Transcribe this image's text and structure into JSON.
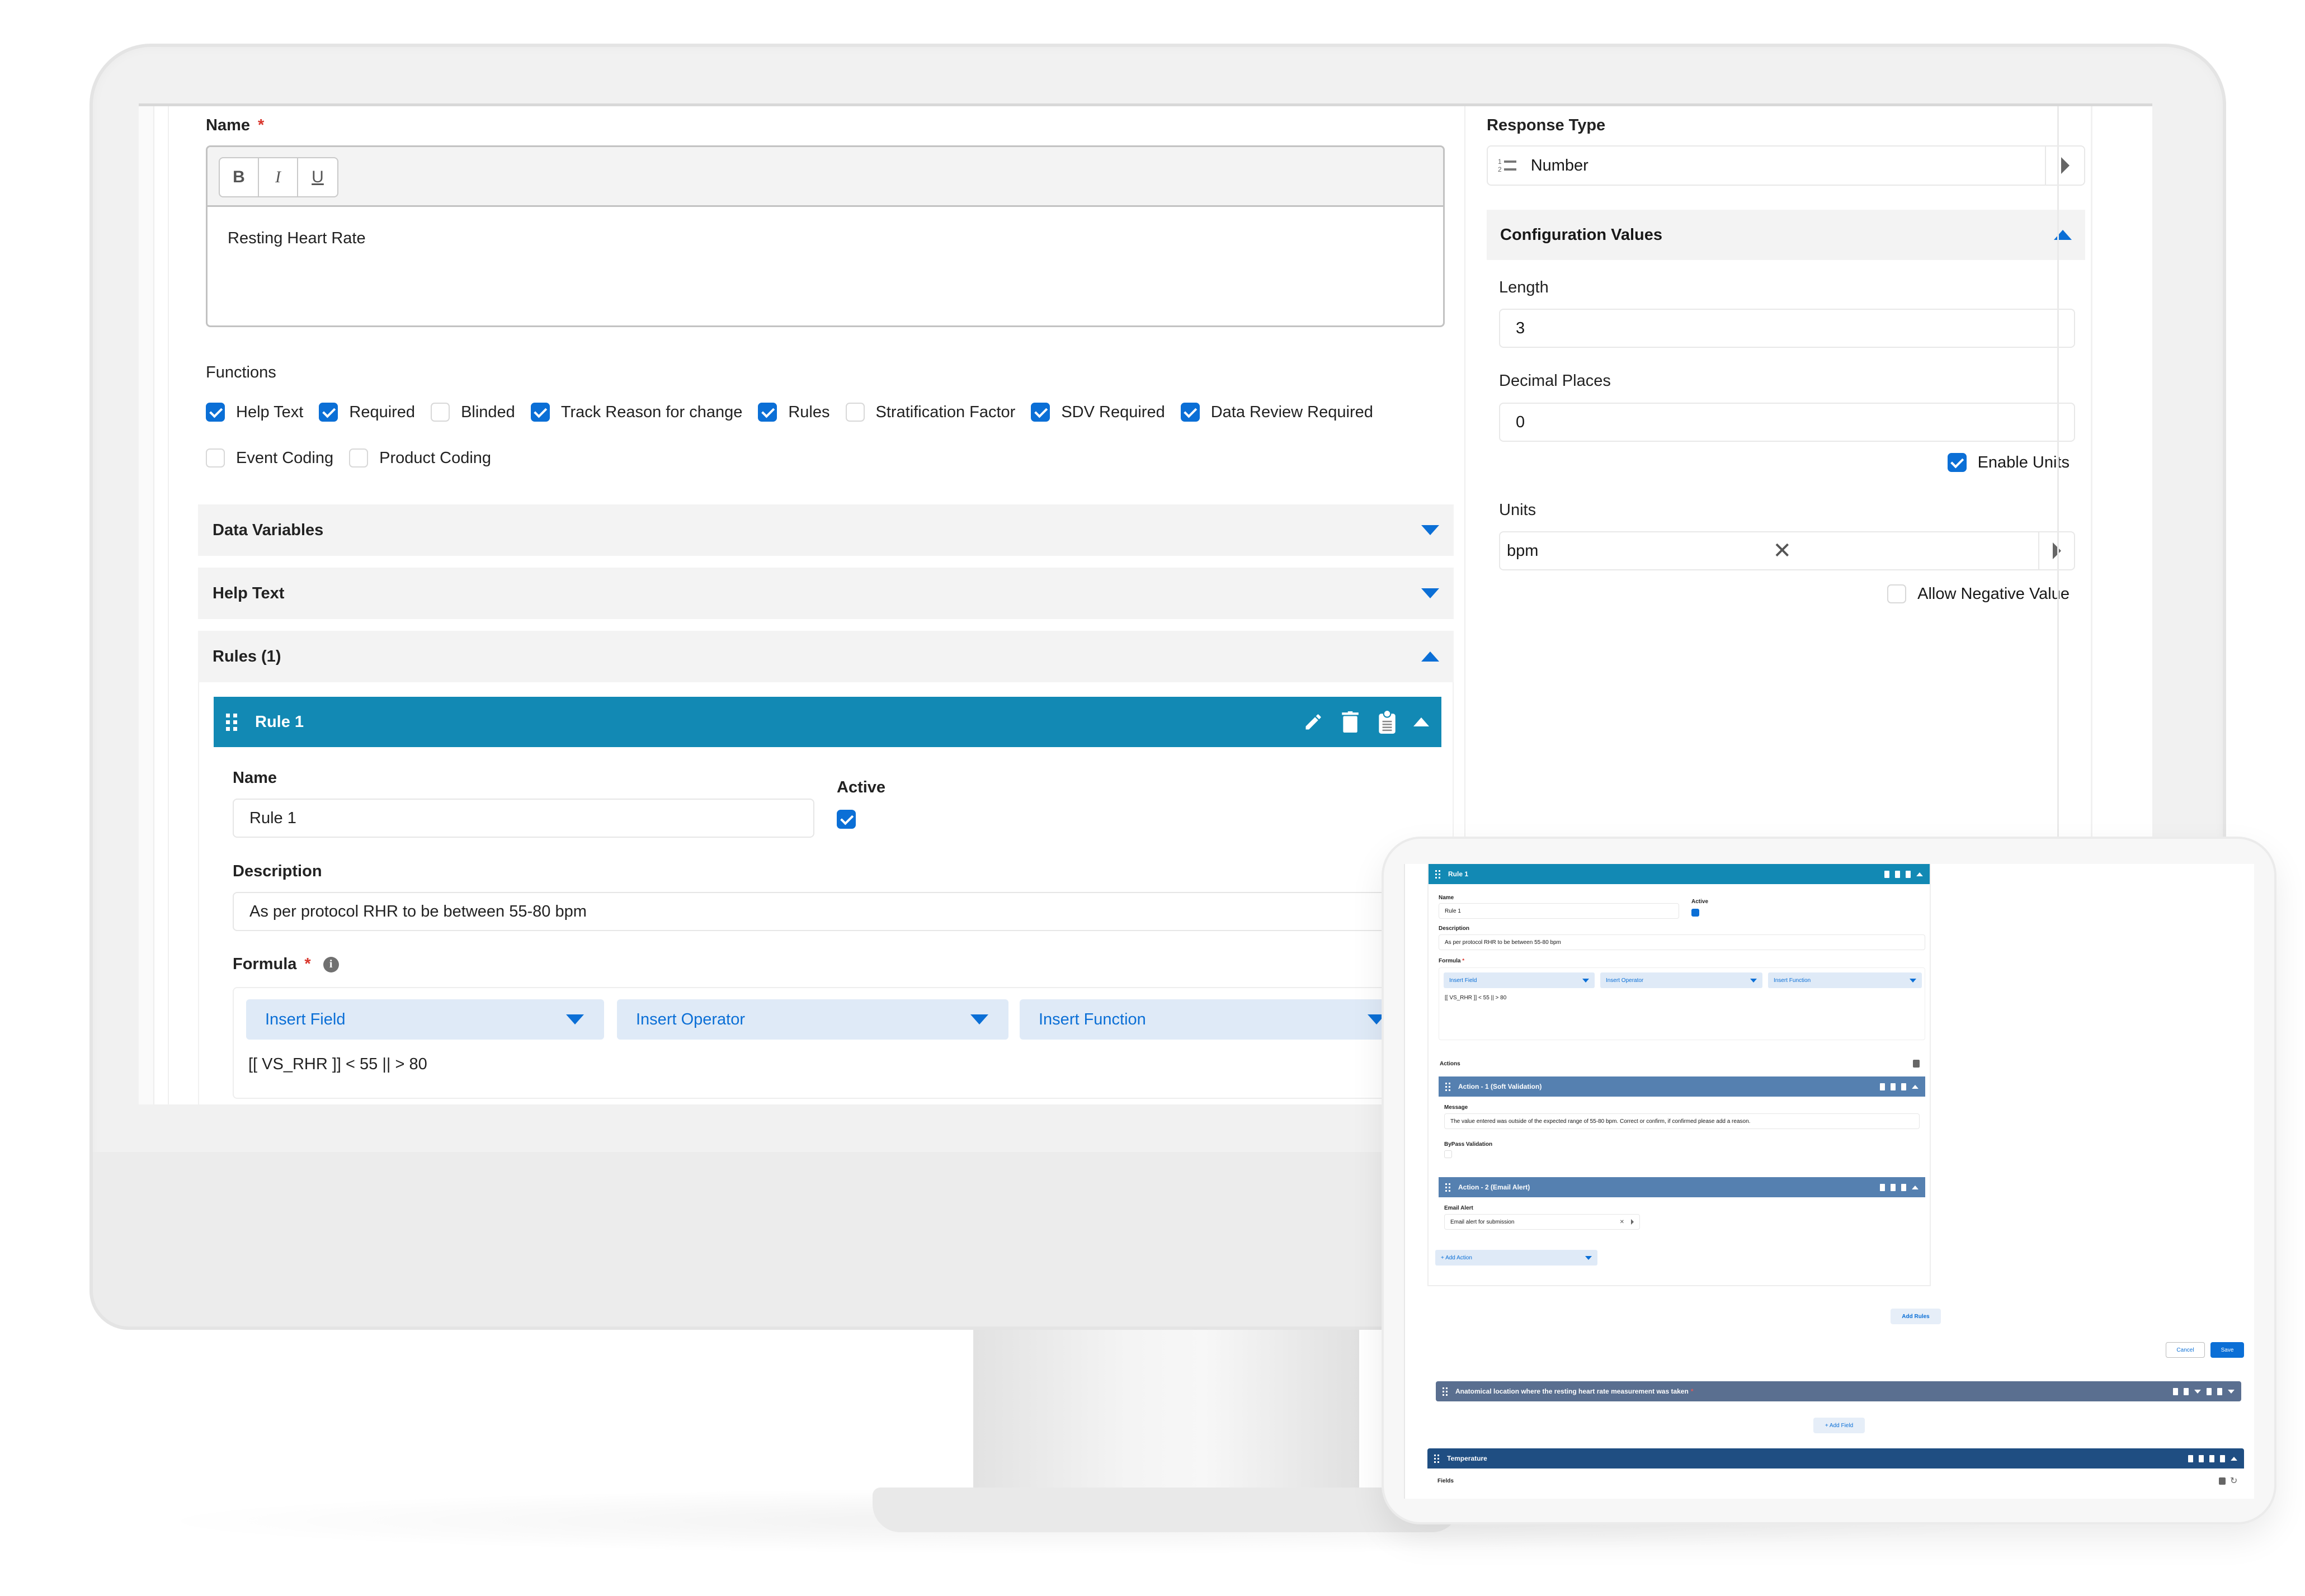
{
  "colors": {
    "accent_blue": "#0b6fd6",
    "rule_header": "#1289b4",
    "action_header": "#5580b0",
    "field_header": "#5a6f90",
    "section_header": "#1f4e82",
    "insert_bg": "#dfeaf7",
    "required_star": "#d9362c"
  },
  "form": {
    "name_label": "Name",
    "required_mark": "*",
    "toolbar": {
      "bold": "B",
      "italic": "I",
      "underline": "U"
    },
    "name_value": "Resting Heart Rate",
    "functions_label": "Functions",
    "functions": [
      {
        "label": "Help Text",
        "checked": true
      },
      {
        "label": "Required",
        "checked": true
      },
      {
        "label": "Blinded",
        "checked": false
      },
      {
        "label": "Track Reason for change",
        "checked": true
      },
      {
        "label": "Rules",
        "checked": true
      },
      {
        "label": "Stratification Factor",
        "checked": false
      },
      {
        "label": "SDV Required",
        "checked": true
      },
      {
        "label": "Data Review Required",
        "checked": true
      },
      {
        "label": "Event Coding",
        "checked": false
      },
      {
        "label": "Product Coding",
        "checked": false
      }
    ],
    "sections": {
      "data_variables": "Data Variables",
      "help_text": "Help Text",
      "rules": "Rules (1)"
    }
  },
  "rule": {
    "title": "Rule 1",
    "name_label": "Name",
    "name_value": "Rule 1",
    "active_label": "Active",
    "active": true,
    "description_label": "Description",
    "description_value": "As per protocol RHR to be between 55-80 bpm",
    "formula_label": "Formula",
    "insert_field": "Insert Field",
    "insert_operator": "Insert Operator",
    "insert_function": "Insert Function",
    "formula_value": "[[ VS_RHR ]]  < 55 ||  > 80"
  },
  "config": {
    "response_type_label": "Response Type",
    "response_type_value": "Number",
    "config_values_label": "Configuration Values",
    "length_label": "Length",
    "length_value": "3",
    "decimal_label": "Decimal Places",
    "decimal_value": "0",
    "enable_units_label": "Enable Units",
    "enable_units": true,
    "units_label": "Units",
    "units_value": "bpm",
    "allow_negative_label": "Allow Negative Value",
    "allow_negative": false
  },
  "tablet": {
    "actions_label": "Actions",
    "action1_title": "Action - 1 (Soft Validation)",
    "message_label": "Message",
    "message_value": "The value entered was outside of the expected range of 55-80 bpm. Correct or confirm, if confirmed please add a reason.",
    "bypass_label": "ByPass Validation",
    "action2_title": "Action - 2 (Email Alert)",
    "email_alert_label": "Email Alert",
    "email_alert_value": "Email alert for submission",
    "add_action": "+ Add Action",
    "add_rules": "Add Rules",
    "cancel": "Cancel",
    "save": "Save",
    "field_title": "Anatomical location where the resting heart rate measurement was taken",
    "add_field": "+ Add Field",
    "section_title": "Temperature",
    "fields_label": "Fields"
  }
}
